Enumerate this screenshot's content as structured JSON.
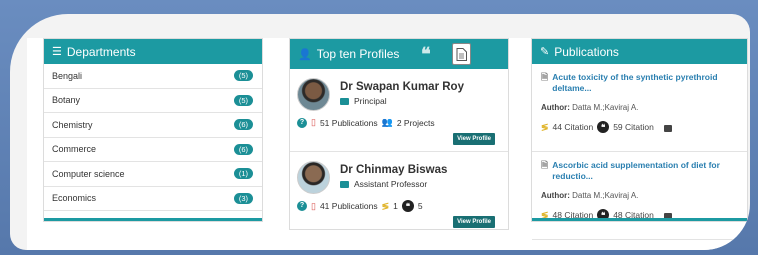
{
  "departments": {
    "title": "Departments",
    "items": [
      {
        "name": "Bengali",
        "count": "(5)"
      },
      {
        "name": "Botany",
        "count": "(5)"
      },
      {
        "name": "Chemistry",
        "count": "(6)"
      },
      {
        "name": "Commerce",
        "count": "(6)"
      },
      {
        "name": "Computer science",
        "count": "(1)"
      },
      {
        "name": "Economics",
        "count": "(3)"
      }
    ]
  },
  "profiles": {
    "title": "Top ten Profiles",
    "items": [
      {
        "name": "Dr Swapan Kumar Roy",
        "role": "Principal",
        "publications": "51 Publications",
        "projects": "2 Projects",
        "button": "View Profile"
      },
      {
        "name": "Dr Chinmay Biswas",
        "role": "Assistant Professor",
        "publications": "41 Publications",
        "rg_count": "1",
        "quote_count": "5",
        "button": "View Profile"
      }
    ]
  },
  "publications": {
    "title": "Publications",
    "items": [
      {
        "title": "Acute toxicity of the synthetic pyrethroid deltame...",
        "author_label": "Author:",
        "author": "Datta M.;Kaviraj A.",
        "citation1": "44 Citation",
        "citation2": "59 Citation"
      },
      {
        "title": "Ascorbic acid supplementation of diet for reductio...",
        "author_label": "Author:",
        "author": "Datta M.;Kaviraj A.",
        "citation1": "48 Citation",
        "citation2": "48 Citation"
      }
    ]
  },
  "colors": {
    "accent": "#1c9aa2",
    "button": "#196f73",
    "link": "#2a7fb0"
  }
}
